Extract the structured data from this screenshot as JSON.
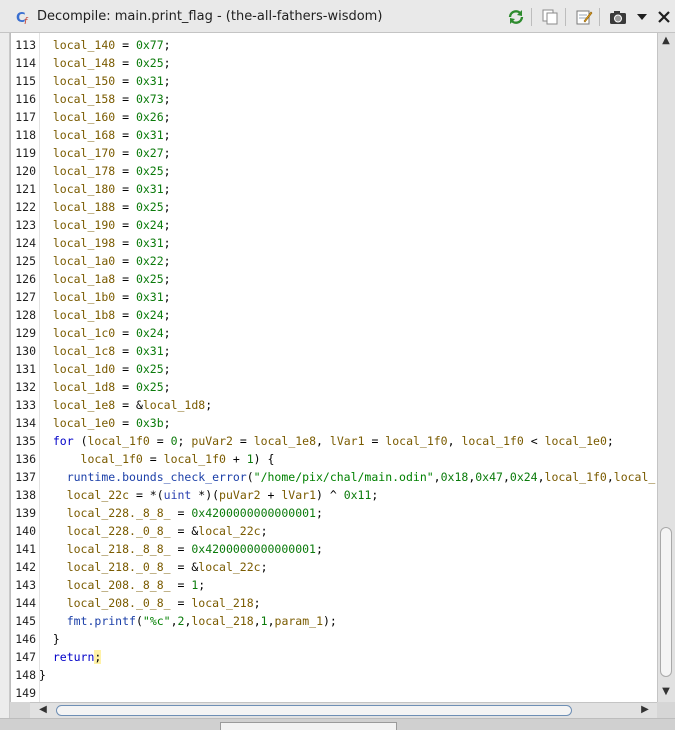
{
  "window": {
    "title": "Decompile: main.print_flag -  (the-all-fathers-wisdom)",
    "icons": [
      "decompile-icon",
      "refresh-icon",
      "copy-icon",
      "edit-icon",
      "snapshot-icon",
      "menu-chevron-icon",
      "close-icon"
    ]
  },
  "code": {
    "lines": [
      {
        "n": "113",
        "tokens": [
          {
            "t": "  "
          },
          {
            "t": "local_140",
            "c": "var"
          },
          {
            "t": " = "
          },
          {
            "t": "0x77",
            "c": "num"
          },
          {
            "t": ";"
          }
        ]
      },
      {
        "n": "114",
        "tokens": [
          {
            "t": "  "
          },
          {
            "t": "local_148",
            "c": "var"
          },
          {
            "t": " = "
          },
          {
            "t": "0x25",
            "c": "num"
          },
          {
            "t": ";"
          }
        ]
      },
      {
        "n": "115",
        "tokens": [
          {
            "t": "  "
          },
          {
            "t": "local_150",
            "c": "var"
          },
          {
            "t": " = "
          },
          {
            "t": "0x31",
            "c": "num"
          },
          {
            "t": ";"
          }
        ]
      },
      {
        "n": "116",
        "tokens": [
          {
            "t": "  "
          },
          {
            "t": "local_158",
            "c": "var"
          },
          {
            "t": " = "
          },
          {
            "t": "0x73",
            "c": "num"
          },
          {
            "t": ";"
          }
        ]
      },
      {
        "n": "117",
        "tokens": [
          {
            "t": "  "
          },
          {
            "t": "local_160",
            "c": "var"
          },
          {
            "t": " = "
          },
          {
            "t": "0x26",
            "c": "num"
          },
          {
            "t": ";"
          }
        ]
      },
      {
        "n": "118",
        "tokens": [
          {
            "t": "  "
          },
          {
            "t": "local_168",
            "c": "var"
          },
          {
            "t": " = "
          },
          {
            "t": "0x31",
            "c": "num"
          },
          {
            "t": ";"
          }
        ]
      },
      {
        "n": "119",
        "tokens": [
          {
            "t": "  "
          },
          {
            "t": "local_170",
            "c": "var"
          },
          {
            "t": " = "
          },
          {
            "t": "0x27",
            "c": "num"
          },
          {
            "t": ";"
          }
        ]
      },
      {
        "n": "120",
        "tokens": [
          {
            "t": "  "
          },
          {
            "t": "local_178",
            "c": "var"
          },
          {
            "t": " = "
          },
          {
            "t": "0x25",
            "c": "num"
          },
          {
            "t": ";"
          }
        ]
      },
      {
        "n": "121",
        "tokens": [
          {
            "t": "  "
          },
          {
            "t": "local_180",
            "c": "var"
          },
          {
            "t": " = "
          },
          {
            "t": "0x31",
            "c": "num"
          },
          {
            "t": ";"
          }
        ]
      },
      {
        "n": "122",
        "tokens": [
          {
            "t": "  "
          },
          {
            "t": "local_188",
            "c": "var"
          },
          {
            "t": " = "
          },
          {
            "t": "0x25",
            "c": "num"
          },
          {
            "t": ";"
          }
        ]
      },
      {
        "n": "123",
        "tokens": [
          {
            "t": "  "
          },
          {
            "t": "local_190",
            "c": "var"
          },
          {
            "t": " = "
          },
          {
            "t": "0x24",
            "c": "num"
          },
          {
            "t": ";"
          }
        ]
      },
      {
        "n": "124",
        "tokens": [
          {
            "t": "  "
          },
          {
            "t": "local_198",
            "c": "var"
          },
          {
            "t": " = "
          },
          {
            "t": "0x31",
            "c": "num"
          },
          {
            "t": ";"
          }
        ]
      },
      {
        "n": "125",
        "tokens": [
          {
            "t": "  "
          },
          {
            "t": "local_1a0",
            "c": "var"
          },
          {
            "t": " = "
          },
          {
            "t": "0x22",
            "c": "num"
          },
          {
            "t": ";"
          }
        ]
      },
      {
        "n": "126",
        "tokens": [
          {
            "t": "  "
          },
          {
            "t": "local_1a8",
            "c": "var"
          },
          {
            "t": " = "
          },
          {
            "t": "0x25",
            "c": "num"
          },
          {
            "t": ";"
          }
        ]
      },
      {
        "n": "127",
        "tokens": [
          {
            "t": "  "
          },
          {
            "t": "local_1b0",
            "c": "var"
          },
          {
            "t": " = "
          },
          {
            "t": "0x31",
            "c": "num"
          },
          {
            "t": ";"
          }
        ]
      },
      {
        "n": "128",
        "tokens": [
          {
            "t": "  "
          },
          {
            "t": "local_1b8",
            "c": "var"
          },
          {
            "t": " = "
          },
          {
            "t": "0x24",
            "c": "num"
          },
          {
            "t": ";"
          }
        ]
      },
      {
        "n": "129",
        "tokens": [
          {
            "t": "  "
          },
          {
            "t": "local_1c0",
            "c": "var"
          },
          {
            "t": " = "
          },
          {
            "t": "0x24",
            "c": "num"
          },
          {
            "t": ";"
          }
        ]
      },
      {
        "n": "130",
        "tokens": [
          {
            "t": "  "
          },
          {
            "t": "local_1c8",
            "c": "var"
          },
          {
            "t": " = "
          },
          {
            "t": "0x31",
            "c": "num"
          },
          {
            "t": ";"
          }
        ]
      },
      {
        "n": "131",
        "tokens": [
          {
            "t": "  "
          },
          {
            "t": "local_1d0",
            "c": "var"
          },
          {
            "t": " = "
          },
          {
            "t": "0x25",
            "c": "num"
          },
          {
            "t": ";"
          }
        ]
      },
      {
        "n": "132",
        "tokens": [
          {
            "t": "  "
          },
          {
            "t": "local_1d8",
            "c": "var"
          },
          {
            "t": " = "
          },
          {
            "t": "0x25",
            "c": "num"
          },
          {
            "t": ";"
          }
        ]
      },
      {
        "n": "133",
        "tokens": [
          {
            "t": "  "
          },
          {
            "t": "local_1e8",
            "c": "var"
          },
          {
            "t": " = &"
          },
          {
            "t": "local_1d8",
            "c": "var"
          },
          {
            "t": ";"
          }
        ]
      },
      {
        "n": "134",
        "tokens": [
          {
            "t": "  "
          },
          {
            "t": "local_1e0",
            "c": "var"
          },
          {
            "t": " = "
          },
          {
            "t": "0x3b",
            "c": "num"
          },
          {
            "t": ";"
          }
        ]
      },
      {
        "n": "135",
        "tokens": [
          {
            "t": "  "
          },
          {
            "t": "for",
            "c": "kw"
          },
          {
            "t": " ("
          },
          {
            "t": "local_1f0",
            "c": "var"
          },
          {
            "t": " = "
          },
          {
            "t": "0",
            "c": "num"
          },
          {
            "t": "; "
          },
          {
            "t": "puVar2",
            "c": "var"
          },
          {
            "t": " = "
          },
          {
            "t": "local_1e8",
            "c": "var"
          },
          {
            "t": ", "
          },
          {
            "t": "lVar1",
            "c": "var"
          },
          {
            "t": " = "
          },
          {
            "t": "local_1f0",
            "c": "var"
          },
          {
            "t": ", "
          },
          {
            "t": "local_1f0",
            "c": "var"
          },
          {
            "t": " < "
          },
          {
            "t": "local_1e0",
            "c": "var"
          },
          {
            "t": ";"
          }
        ]
      },
      {
        "n": "136",
        "tokens": [
          {
            "t": "      "
          },
          {
            "t": "local_1f0",
            "c": "var"
          },
          {
            "t": " = "
          },
          {
            "t": "local_1f0",
            "c": "var"
          },
          {
            "t": " + "
          },
          {
            "t": "1",
            "c": "num"
          },
          {
            "t": ") {"
          }
        ]
      },
      {
        "n": "137",
        "tokens": [
          {
            "t": "    "
          },
          {
            "t": "runtime.bounds_check_error",
            "c": "fn"
          },
          {
            "t": "("
          },
          {
            "t": "\"/home/pix/chal/main.odin\"",
            "c": "str"
          },
          {
            "t": ","
          },
          {
            "t": "0x18",
            "c": "num"
          },
          {
            "t": ","
          },
          {
            "t": "0x47",
            "c": "num"
          },
          {
            "t": ","
          },
          {
            "t": "0x24",
            "c": "num"
          },
          {
            "t": ","
          },
          {
            "t": "local_1f0",
            "c": "var"
          },
          {
            "t": ","
          },
          {
            "t": "local_",
            "c": "var"
          }
        ]
      },
      {
        "n": "138",
        "tokens": [
          {
            "t": "    "
          },
          {
            "t": "local_22c",
            "c": "var"
          },
          {
            "t": " = *("
          },
          {
            "t": "uint",
            "c": "typ"
          },
          {
            "t": " *)("
          },
          {
            "t": "puVar2",
            "c": "var"
          },
          {
            "t": " + "
          },
          {
            "t": "lVar1",
            "c": "var"
          },
          {
            "t": ") ^ "
          },
          {
            "t": "0x11",
            "c": "num"
          },
          {
            "t": ";"
          }
        ]
      },
      {
        "n": "139",
        "tokens": [
          {
            "t": "    "
          },
          {
            "t": "local_228._8_8_",
            "c": "var"
          },
          {
            "t": " = "
          },
          {
            "t": "0x4200000000000001",
            "c": "num"
          },
          {
            "t": ";"
          }
        ]
      },
      {
        "n": "140",
        "tokens": [
          {
            "t": "    "
          },
          {
            "t": "local_228._0_8_",
            "c": "var"
          },
          {
            "t": " = &"
          },
          {
            "t": "local_22c",
            "c": "var"
          },
          {
            "t": ";"
          }
        ]
      },
      {
        "n": "141",
        "tokens": [
          {
            "t": "    "
          },
          {
            "t": "local_218._8_8_",
            "c": "var"
          },
          {
            "t": " = "
          },
          {
            "t": "0x4200000000000001",
            "c": "num"
          },
          {
            "t": ";"
          }
        ]
      },
      {
        "n": "142",
        "tokens": [
          {
            "t": "    "
          },
          {
            "t": "local_218._0_8_",
            "c": "var"
          },
          {
            "t": " = &"
          },
          {
            "t": "local_22c",
            "c": "var"
          },
          {
            "t": ";"
          }
        ]
      },
      {
        "n": "143",
        "tokens": [
          {
            "t": "    "
          },
          {
            "t": "local_208._8_8_",
            "c": "var"
          },
          {
            "t": " = "
          },
          {
            "t": "1",
            "c": "num"
          },
          {
            "t": ";"
          }
        ]
      },
      {
        "n": "144",
        "tokens": [
          {
            "t": "    "
          },
          {
            "t": "local_208._0_8_",
            "c": "var"
          },
          {
            "t": " = "
          },
          {
            "t": "local_218",
            "c": "var"
          },
          {
            "t": ";"
          }
        ]
      },
      {
        "n": "145",
        "tokens": [
          {
            "t": "    "
          },
          {
            "t": "fmt.printf",
            "c": "fn"
          },
          {
            "t": "("
          },
          {
            "t": "\"%c\"",
            "c": "str"
          },
          {
            "t": ","
          },
          {
            "t": "2",
            "c": "num"
          },
          {
            "t": ","
          },
          {
            "t": "local_218",
            "c": "var"
          },
          {
            "t": ","
          },
          {
            "t": "1",
            "c": "num"
          },
          {
            "t": ","
          },
          {
            "t": "param_1",
            "c": "var"
          },
          {
            "t": ");"
          }
        ]
      },
      {
        "n": "146",
        "tokens": [
          {
            "t": "  }"
          }
        ]
      },
      {
        "n": "147",
        "tokens": [
          {
            "t": "  "
          },
          {
            "t": "return",
            "c": "kw"
          },
          {
            "t": ";",
            "c": "hl"
          }
        ]
      },
      {
        "n": "148",
        "tokens": [
          {
            "t": "}"
          }
        ]
      },
      {
        "n": "149",
        "tokens": []
      }
    ]
  },
  "colors": {
    "variable": "#7a5b00",
    "number": "#0a7a0a",
    "keyword": "#0000c8",
    "function": "#1b3fa8",
    "string": "#008000",
    "highlight": "#fff2a8"
  }
}
